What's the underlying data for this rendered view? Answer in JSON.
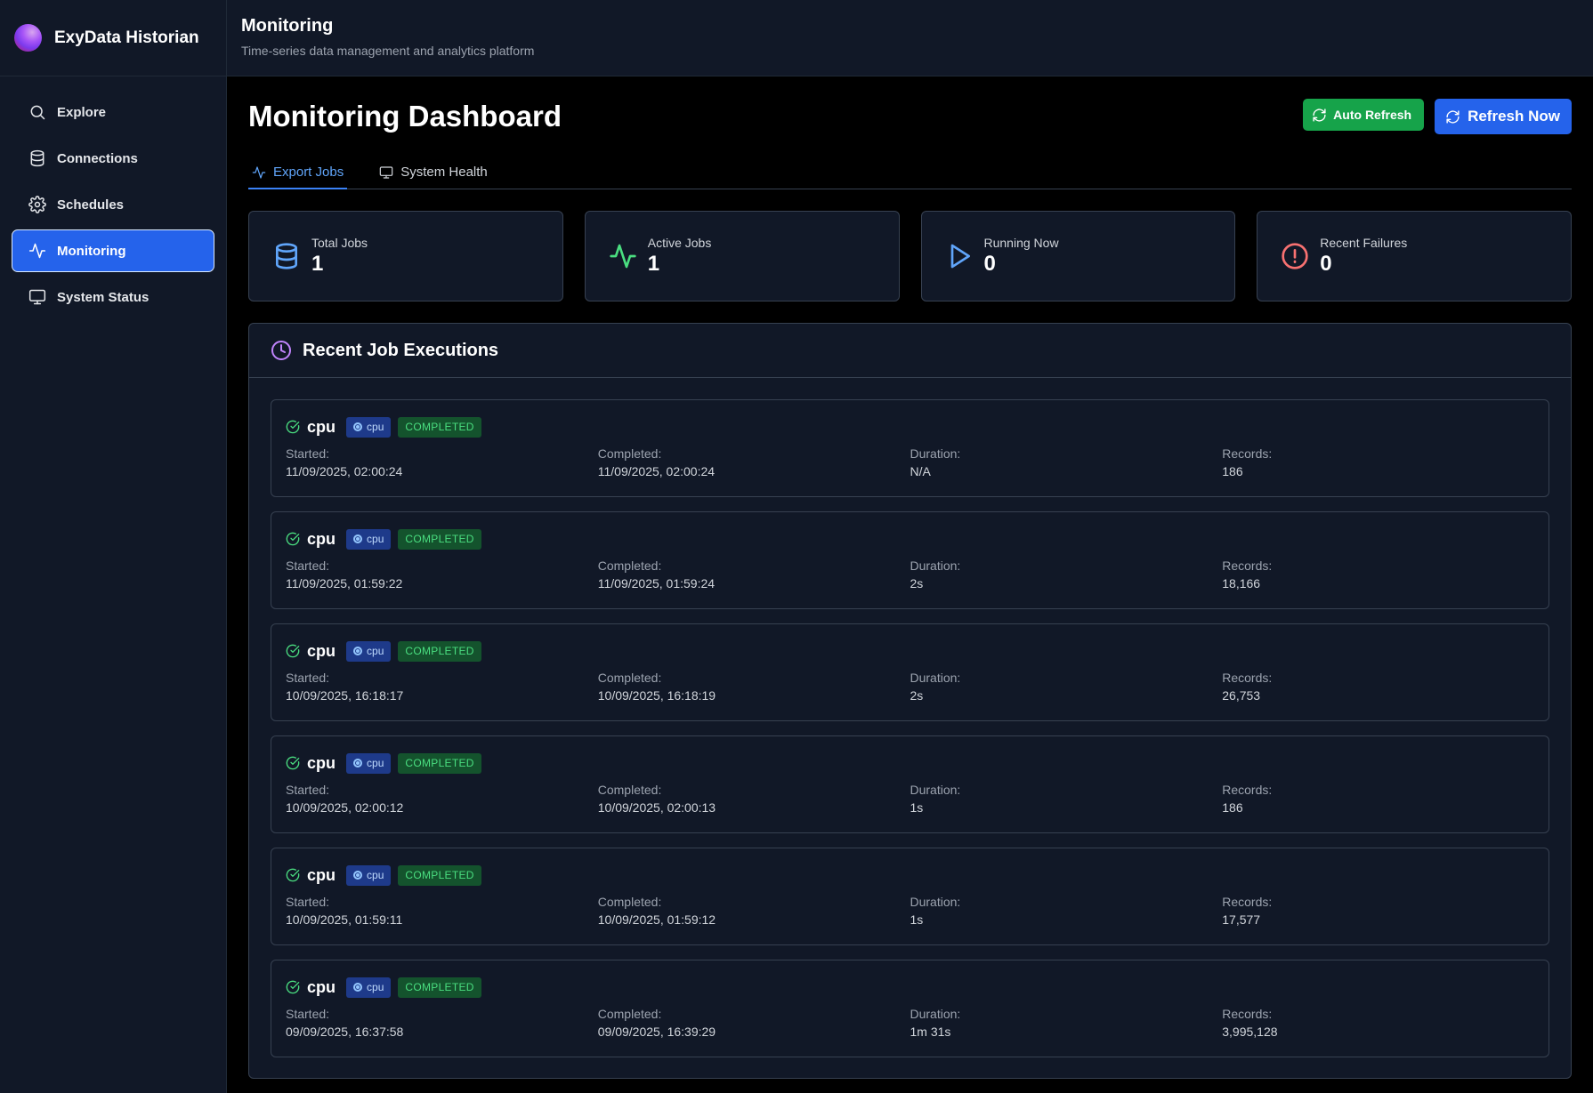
{
  "app": {
    "name": "ExyData Historian"
  },
  "header": {
    "title": "Monitoring",
    "subtitle": "Time-series data management and analytics platform"
  },
  "sidebar": {
    "items": [
      {
        "label": "Explore",
        "icon": "search-icon"
      },
      {
        "label": "Connections",
        "icon": "database-icon"
      },
      {
        "label": "Schedules",
        "icon": "gear-icon"
      },
      {
        "label": "Monitoring",
        "icon": "activity-icon",
        "active": true
      },
      {
        "label": "System Status",
        "icon": "monitor-icon"
      }
    ]
  },
  "page": {
    "title": "Monitoring Dashboard",
    "auto_refresh_label": "Auto Refresh",
    "refresh_now_label": "Refresh Now"
  },
  "tabs": [
    {
      "label": "Export Jobs",
      "icon": "activity-icon",
      "active": true
    },
    {
      "label": "System Health",
      "icon": "monitor-icon"
    }
  ],
  "stats": [
    {
      "label": "Total Jobs",
      "value": "1",
      "icon": "database-icon",
      "color": "#60a5fa"
    },
    {
      "label": "Active Jobs",
      "value": "1",
      "icon": "activity-icon",
      "color": "#4ade80"
    },
    {
      "label": "Running Now",
      "value": "0",
      "icon": "play-icon",
      "color": "#60a5fa"
    },
    {
      "label": "Recent Failures",
      "value": "0",
      "icon": "alert-circle-icon",
      "color": "#f87171"
    }
  ],
  "executions": {
    "title": "Recent Job Executions",
    "labels": {
      "started": "Started:",
      "completed": "Completed:",
      "duration": "Duration:",
      "records": "Records:"
    },
    "items": [
      {
        "name": "cpu",
        "tag": "cpu",
        "status": "COMPLETED",
        "started": "11/09/2025, 02:00:24",
        "completed": "11/09/2025, 02:00:24",
        "duration": "N/A",
        "records": "186"
      },
      {
        "name": "cpu",
        "tag": "cpu",
        "status": "COMPLETED",
        "started": "11/09/2025, 01:59:22",
        "completed": "11/09/2025, 01:59:24",
        "duration": "2s",
        "records": "18,166"
      },
      {
        "name": "cpu",
        "tag": "cpu",
        "status": "COMPLETED",
        "started": "10/09/2025, 16:18:17",
        "completed": "10/09/2025, 16:18:19",
        "duration": "2s",
        "records": "26,753"
      },
      {
        "name": "cpu",
        "tag": "cpu",
        "status": "COMPLETED",
        "started": "10/09/2025, 02:00:12",
        "completed": "10/09/2025, 02:00:13",
        "duration": "1s",
        "records": "186"
      },
      {
        "name": "cpu",
        "tag": "cpu",
        "status": "COMPLETED",
        "started": "10/09/2025, 01:59:11",
        "completed": "10/09/2025, 01:59:12",
        "duration": "1s",
        "records": "17,577"
      },
      {
        "name": "cpu",
        "tag": "cpu",
        "status": "COMPLETED",
        "started": "09/09/2025, 16:37:58",
        "completed": "09/09/2025, 16:39:29",
        "duration": "1m 31s",
        "records": "3,995,128"
      }
    ]
  },
  "colors": {
    "accent": "#2563eb",
    "success": "#16a34a",
    "panel": "#111827",
    "border": "#374151"
  }
}
